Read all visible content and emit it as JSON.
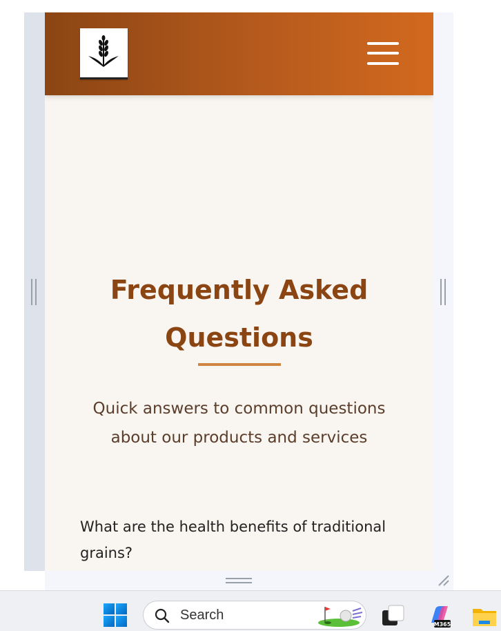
{
  "page": {
    "faq_title": "Frequently Asked Questions",
    "subtitle": "Quick answers to common questions about our products and services",
    "first_question": "What are the health benefits of traditional grains?"
  },
  "header": {
    "logo_icon": "wheat-icon",
    "menu_icon": "hamburger-menu-icon",
    "gradient_colors": [
      "#8b4513",
      "#d2691e"
    ]
  },
  "colors": {
    "title": "#8b4513",
    "divider": "#cd853f",
    "background": "#f9f5f0"
  },
  "taskbar": {
    "search_placeholder": "Search",
    "icons": [
      "windows-start-icon",
      "search-icon",
      "golf-search-highlight",
      "task-view-icon",
      "m365-copilot-icon",
      "file-explorer-icon"
    ],
    "m365_badge": "M365"
  }
}
